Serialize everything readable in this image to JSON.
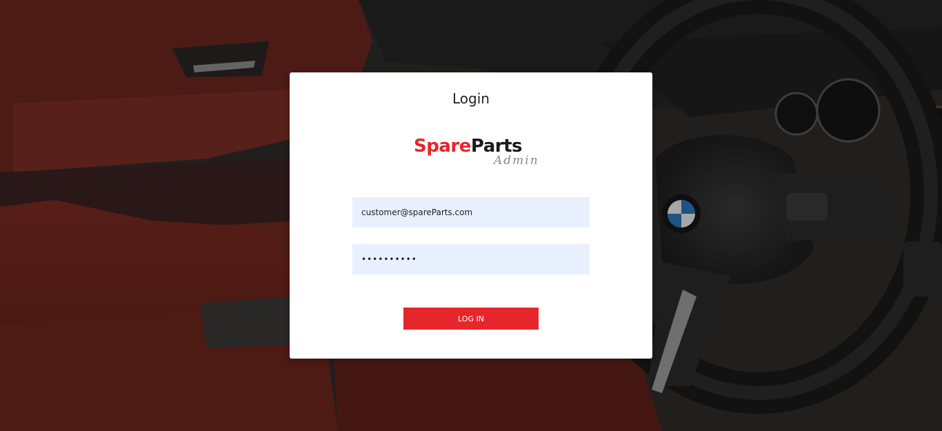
{
  "login": {
    "title": "Login",
    "logo": {
      "spare": "Spare",
      "parts": "Parts",
      "sub": "Admin"
    },
    "email": {
      "value": "customer@spareParts.com",
      "placeholder": ""
    },
    "password": {
      "value": "••••••••••",
      "placeholder": ""
    },
    "button_label": "LOG IN"
  },
  "colors": {
    "accent": "#e6262b",
    "input_bg": "#e8f0fe",
    "card_bg": "#ffffff"
  }
}
